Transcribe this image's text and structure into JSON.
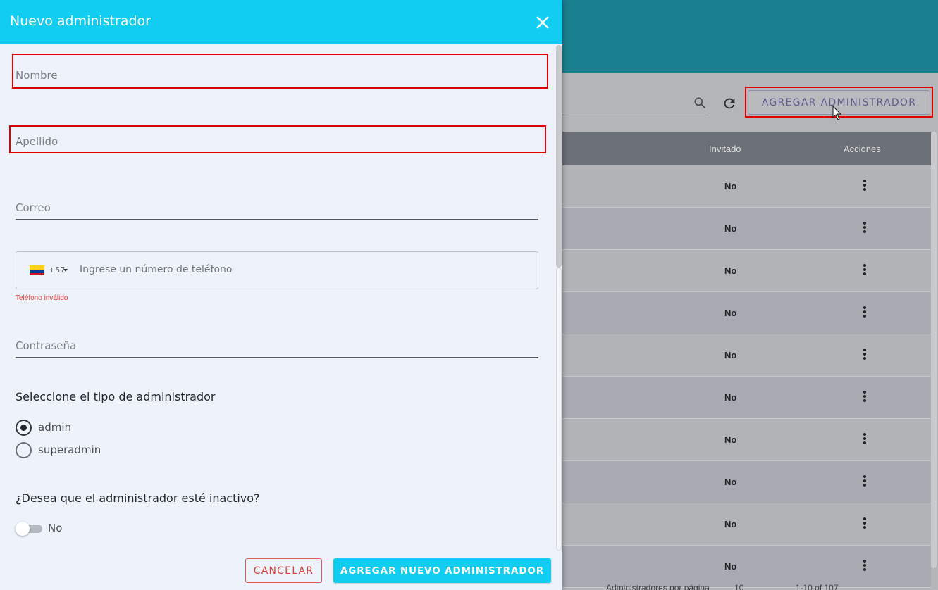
{
  "background": {
    "add_button_label": "AGREGAR ADMINISTRADOR",
    "table": {
      "headers": [
        "Invitado",
        "Acciones"
      ],
      "rows": [
        {
          "invitado": "No"
        },
        {
          "invitado": "No"
        },
        {
          "invitado": "No"
        },
        {
          "invitado": "No"
        },
        {
          "invitado": "No"
        },
        {
          "invitado": "No"
        },
        {
          "invitado": "No"
        },
        {
          "invitado": "No"
        },
        {
          "invitado": "No"
        },
        {
          "invitado": "No"
        }
      ]
    },
    "footer": {
      "rows_per_page_label": "Administradores por página",
      "rows_per_page": "10",
      "range": "1-10 of 107"
    },
    "colors": {
      "header": "#1a7f8e",
      "highlight": "#e00000"
    }
  },
  "modal": {
    "title": "Nuevo administrador",
    "fields": {
      "nombre": "Nombre",
      "apellido": "Apellido",
      "correo": "Correo",
      "contrasena": "Contraseña"
    },
    "phone": {
      "country_flag": "colombia-flag-icon",
      "dial_code": "+57",
      "placeholder": "Ingrese un número de teléfono",
      "value": "",
      "error": "Teléfono inválido"
    },
    "admin_type": {
      "title": "Seleccione el tipo de administrador",
      "options": [
        {
          "label": "admin",
          "selected": true
        },
        {
          "label": "superadmin",
          "selected": false
        }
      ]
    },
    "inactive": {
      "question": "¿Desea que el administrador esté inactivo?",
      "toggle_on": false,
      "label": "No"
    },
    "buttons": {
      "cancel": "CANCELAR",
      "submit": "AGREGAR NUEVO ADMINISTRADOR"
    },
    "colors": {
      "primary": "#12cdf2",
      "danger": "#e0433a"
    }
  }
}
